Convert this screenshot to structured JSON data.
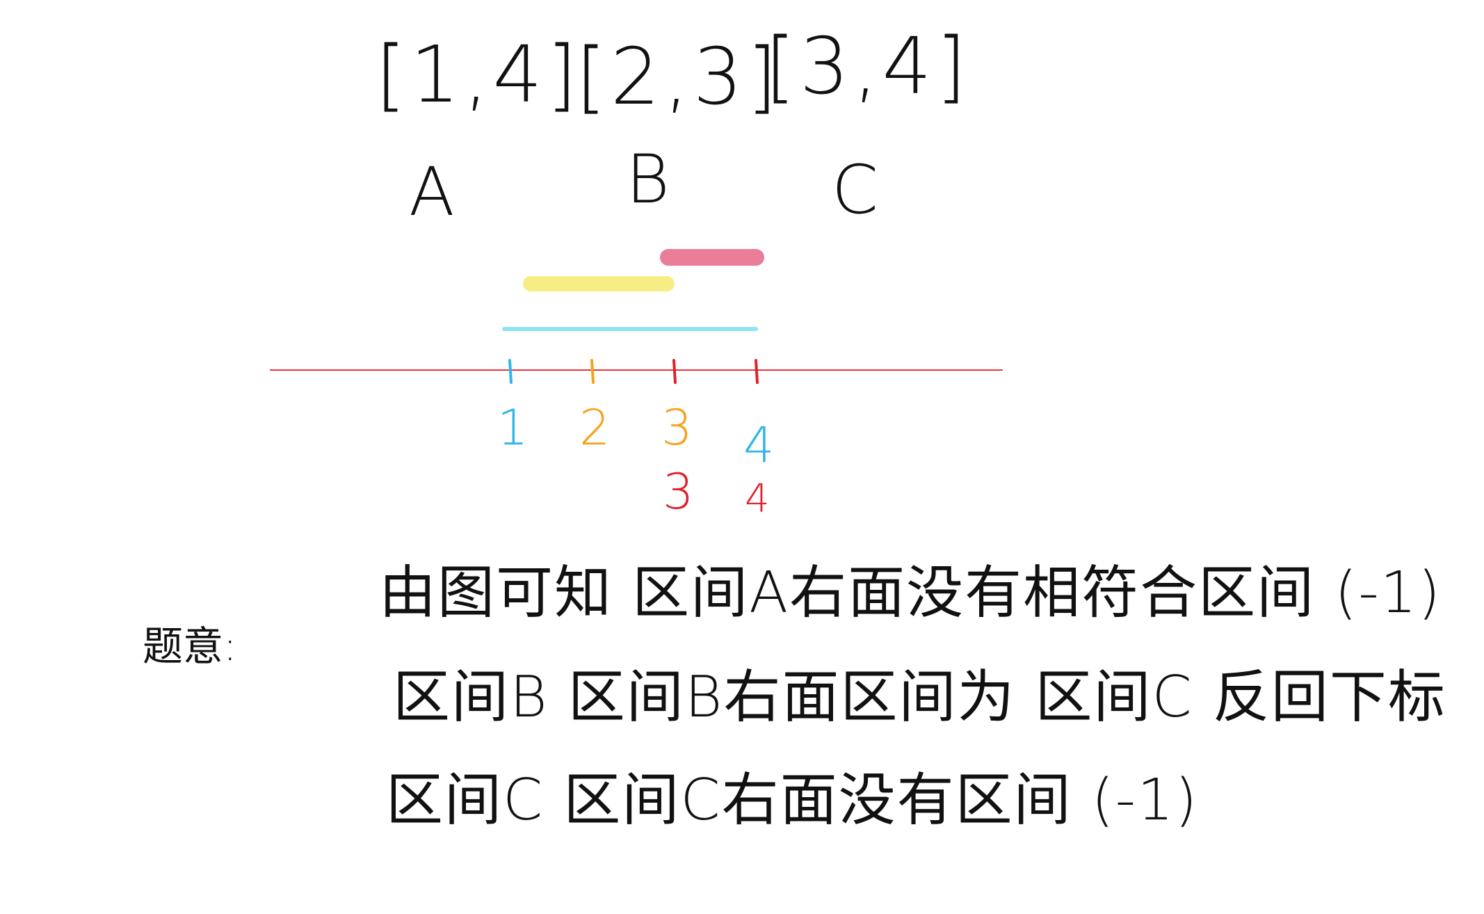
{
  "intervals": [
    {
      "label": "[1,4]",
      "name": "A"
    },
    {
      "label": "[2,3]",
      "name": "B"
    },
    {
      "label": "[3,4]",
      "name": "C"
    }
  ],
  "axis": {
    "line_color": "#e8343a",
    "ticks": [
      {
        "value": 1,
        "label": "1",
        "color": "#2fb6ea",
        "end_label": ""
      },
      {
        "value": 2,
        "label": "2",
        "color": "#f5a21b",
        "end_label": ""
      },
      {
        "value": 3,
        "label": "3",
        "color": "#f5a21b",
        "end_label": "3",
        "end_color": "#e0202a"
      },
      {
        "value": 4,
        "label": "4",
        "color": "#2fb6ea",
        "end_label": "4",
        "end_color": "#e0202a"
      }
    ],
    "segments": [
      {
        "interval": "A",
        "start": 1,
        "end": 4,
        "color": "#8fe3f5"
      },
      {
        "interval": "B",
        "start": 2,
        "end": 3,
        "color": "#f7ec7a"
      },
      {
        "interval": "C",
        "start": 3,
        "end": 4,
        "color": "#e9738f"
      }
    ]
  },
  "notes": {
    "lead": "题意:",
    "lines": [
      "由图可知 区间A右面没有相符合区间 (-1)",
      "区间B  区间B右面区间为 区间C 反回下标",
      "区间C  区间C右面没有区间 (-1)"
    ]
  }
}
